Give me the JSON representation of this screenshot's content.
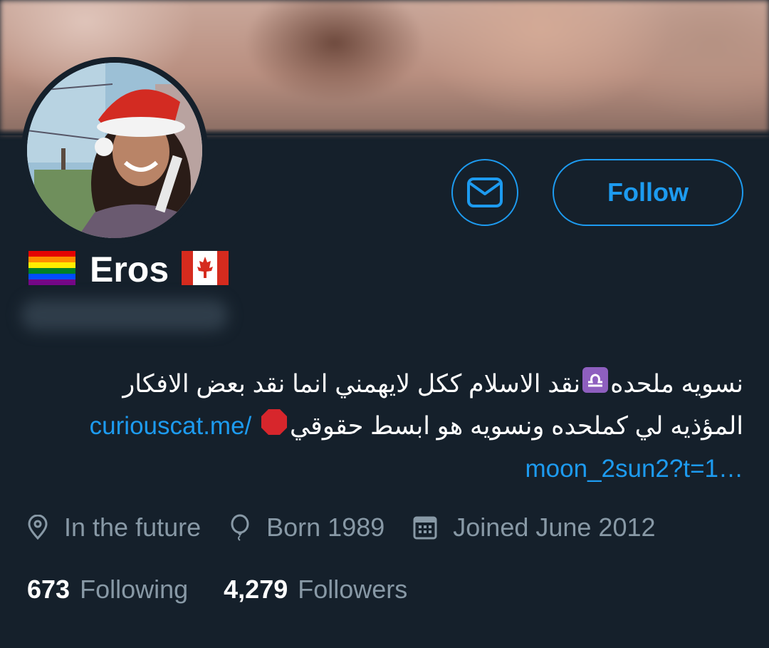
{
  "profile": {
    "display_name": "Eros",
    "bio_line_1": "نسويه ملحده",
    "bio_line_1b": "نقد الاسلام ككل لايهمني انما نقد بعض الافكار",
    "bio_line_2": "المؤذيه لي كملحده ونسويه هو ابسط حقوقي",
    "bio_link_part1": "curiouscat.me/",
    "bio_link_part2": "moon_2sun2?t=1…",
    "location": "In the future",
    "birthday": "Born 1989",
    "joined": "Joined June 2012",
    "following_count": "673",
    "following_label": "Following",
    "followers_count": "4,279",
    "followers_label": "Followers"
  },
  "buttons": {
    "follow_label": "Follow"
  },
  "icons": {
    "message": "mail-icon",
    "location": "location-pin-icon",
    "birthday": "balloon-icon",
    "joined": "calendar-icon"
  },
  "colors": {
    "background": "#15202b",
    "accent": "#1d9bf0",
    "secondary_text": "#8899a6"
  }
}
